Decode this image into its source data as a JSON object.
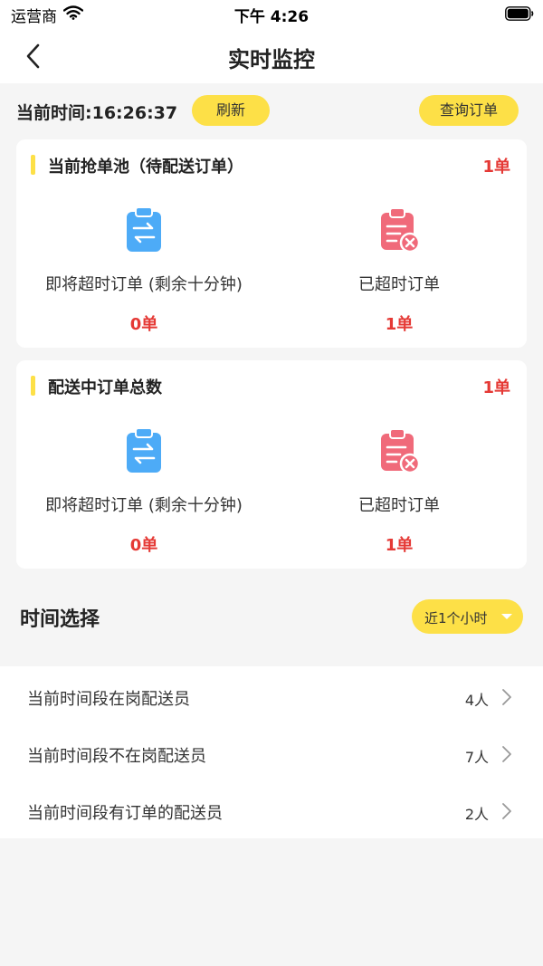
{
  "status_bar": {
    "carrier": "运营商",
    "time": "下午 4:26"
  },
  "nav": {
    "title": "实时监控"
  },
  "time_bar": {
    "current_time": "当前时间:16:26:37",
    "refresh": "刷新",
    "query_orders": "查询订单"
  },
  "cards": [
    {
      "title": "当前抢单池（待配送订单）",
      "count": "1单",
      "stats": [
        {
          "icon": "clipboard-transfer-icon",
          "label": "即将超时订单 (剩余十分钟)",
          "value": "0单"
        },
        {
          "icon": "clipboard-cancel-icon",
          "label": "已超时订单",
          "value": "1单"
        }
      ]
    },
    {
      "title": "配送中订单总数",
      "count": "1单",
      "stats": [
        {
          "icon": "clipboard-transfer-icon",
          "label": "即将超时订单 (剩余十分钟)",
          "value": "0单"
        },
        {
          "icon": "clipboard-cancel-icon",
          "label": "已超时订单",
          "value": "1单"
        }
      ]
    }
  ],
  "time_select": {
    "title": "时间选择",
    "selected": "近1个小时"
  },
  "rider_list": [
    {
      "label": "当前时间段在岗配送员",
      "value": "4人"
    },
    {
      "label": "当前时间段不在岗配送员",
      "value": "7人"
    },
    {
      "label": "当前时间段有订单的配送员",
      "value": "2人"
    }
  ],
  "colors": {
    "accent": "#fde047",
    "alert": "#e53935",
    "blue_icon": "#4dabf7",
    "red_icon": "#f06a7a"
  }
}
